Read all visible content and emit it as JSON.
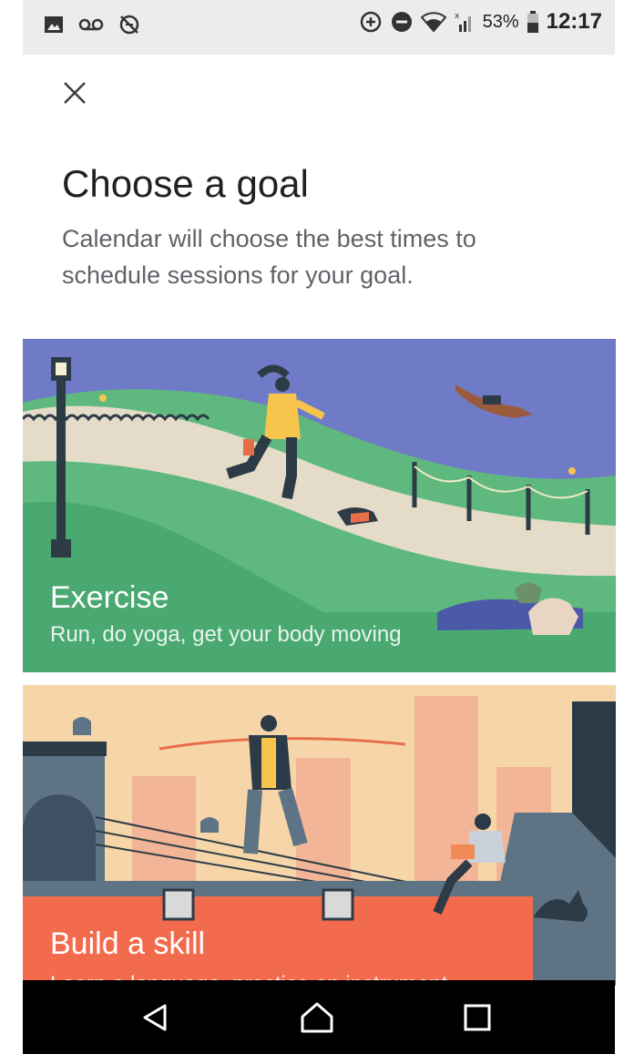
{
  "status_bar": {
    "battery_percent": "53%",
    "time": "12:17",
    "icons": [
      "image-icon",
      "voicemail-icon",
      "sync-off-icon",
      "data-saver-icon",
      "do-not-disturb-icon",
      "wifi-icon",
      "cell-signal-icon",
      "battery-icon"
    ]
  },
  "header": {
    "close_icon": "close-icon",
    "title": "Choose a goal",
    "subtitle": "Calendar will choose the best times to schedule sessions for your goal."
  },
  "goals": [
    {
      "title": "Exercise",
      "description": "Run, do yoga, get your body moving"
    },
    {
      "title": "Build a skill",
      "description": "Learn a language, practice an instrument"
    }
  ],
  "nav_bar": {
    "icons": [
      "back-icon",
      "home-icon",
      "recents-icon"
    ]
  },
  "colors": {
    "sky_exercise": "#6f7bc6",
    "grass": "#5fb97f",
    "sky_skill": "#f6d6a8",
    "roof": "#f26b4c"
  }
}
